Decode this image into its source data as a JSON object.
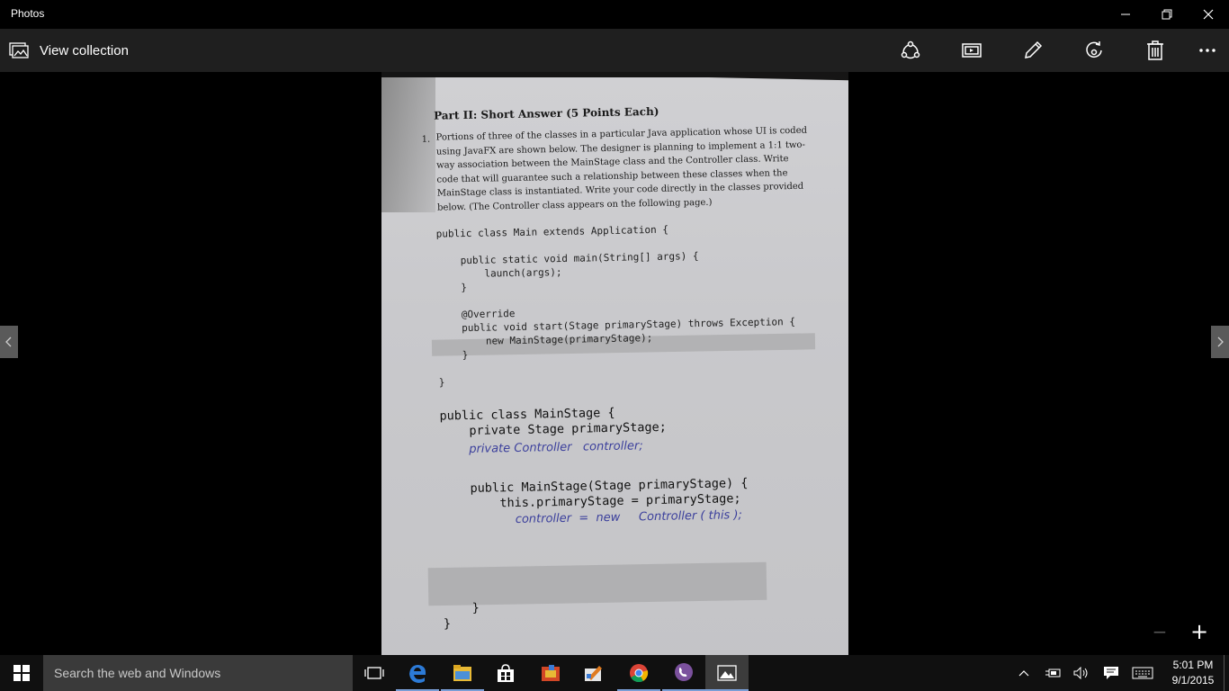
{
  "window": {
    "title": "Photos"
  },
  "toolbar": {
    "view_collection_label": "View collection",
    "actions": [
      "share-icon",
      "slideshow-icon",
      "edit-pencil-icon",
      "rotate-icon",
      "delete-icon",
      "more-icon"
    ]
  },
  "photo": {
    "heading": "Part II: Short Answer (5 Points Each)",
    "question_number": "1.",
    "paragraph": "Portions of three of the classes in a particular Java application whose UI is coded\nusing JavaFX  are shown below. The designer is planning to implement a 1:1 two-\nway association between the MainStage class and the Controller class. Write\ncode that will guarantee such a relationship between these classes when the\nMainStage class is instantiated. Write your code directly in the classes provided\nbelow. (The Controller class appears on the following page.)",
    "code_main": "public class Main extends Application {\n\n    public static void main(String[] args) {\n        launch(args);\n    }\n\n    @Override\n    public void start(Stage primaryStage) throws Exception {\n        new MainStage(primaryStage);\n    }\n\n}",
    "code_mainstage_1": "public class MainStage {\n    private Stage primaryStage;",
    "handwriting_1": "private Controller   controller;",
    "code_mainstage_2": "    public MainStage(Stage primaryStage) {\n        this.primaryStage = primaryStage;",
    "handwriting_2": "controller  =  new     Controller ( this );",
    "code_close_1": "}",
    "code_close_2": "}"
  },
  "zoom": {
    "out": "−",
    "in": "+"
  },
  "taskbar": {
    "search_placeholder": "Search the web and Windows",
    "apps": [
      "task-view-icon",
      "edge-icon",
      "file-explorer-icon",
      "store-icon",
      "office-icon",
      "paint-icon",
      "chrome-icon",
      "viber-icon",
      "photos-icon"
    ],
    "time": "5:01 PM",
    "date": "9/1/2015"
  }
}
